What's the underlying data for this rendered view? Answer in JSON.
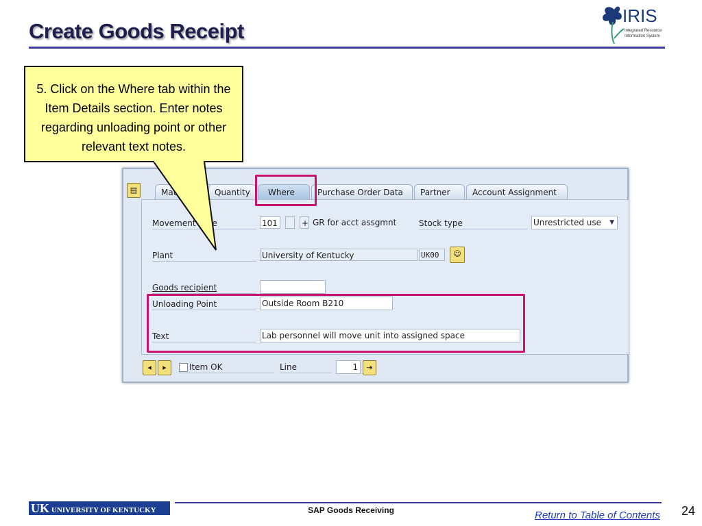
{
  "header": {
    "title": "Create Goods Receipt",
    "logo_text": "IRIS",
    "logo_subtitle": "Integrated Resource Information System"
  },
  "callout": {
    "text": "5. Click on the Where tab within the Item Details section. Enter notes regarding unloading point or other relevant text notes."
  },
  "sap": {
    "tabs": [
      {
        "label": "Material"
      },
      {
        "label": "Quantity"
      },
      {
        "label": "Where",
        "active": true
      },
      {
        "label": "Purchase Order Data"
      },
      {
        "label": "Partner"
      },
      {
        "label": "Account Assignment"
      }
    ],
    "movement_type_label": "Movement Type",
    "movement_type_value": "101",
    "movement_type_sign": "+",
    "movement_type_desc": "GR for acct assgmnt",
    "stock_type_label": "Stock type",
    "stock_type_value": "Unrestricted use",
    "plant_label": "Plant",
    "plant_value": "University of Kentucky",
    "plant_code": "UK00",
    "goods_recipient_label": "Goods recipient",
    "goods_recipient_value": "",
    "unloading_point_label": "Unloading Point",
    "unloading_point_value": "Outside Room B210",
    "text_label": "Text",
    "text_value": "Lab personnel will move unit into assigned space",
    "item_ok_label": "Item OK",
    "item_ok_checked": false,
    "line_label": "Line",
    "line_value": "1"
  },
  "highlight_color": "#c8146e",
  "footer": {
    "uk_logo_text": "UK UNIVERSITY OF KENTUCKY",
    "title": "SAP Goods Receiving",
    "toc_link": "Return to Table of Contents",
    "page_number": "24"
  }
}
